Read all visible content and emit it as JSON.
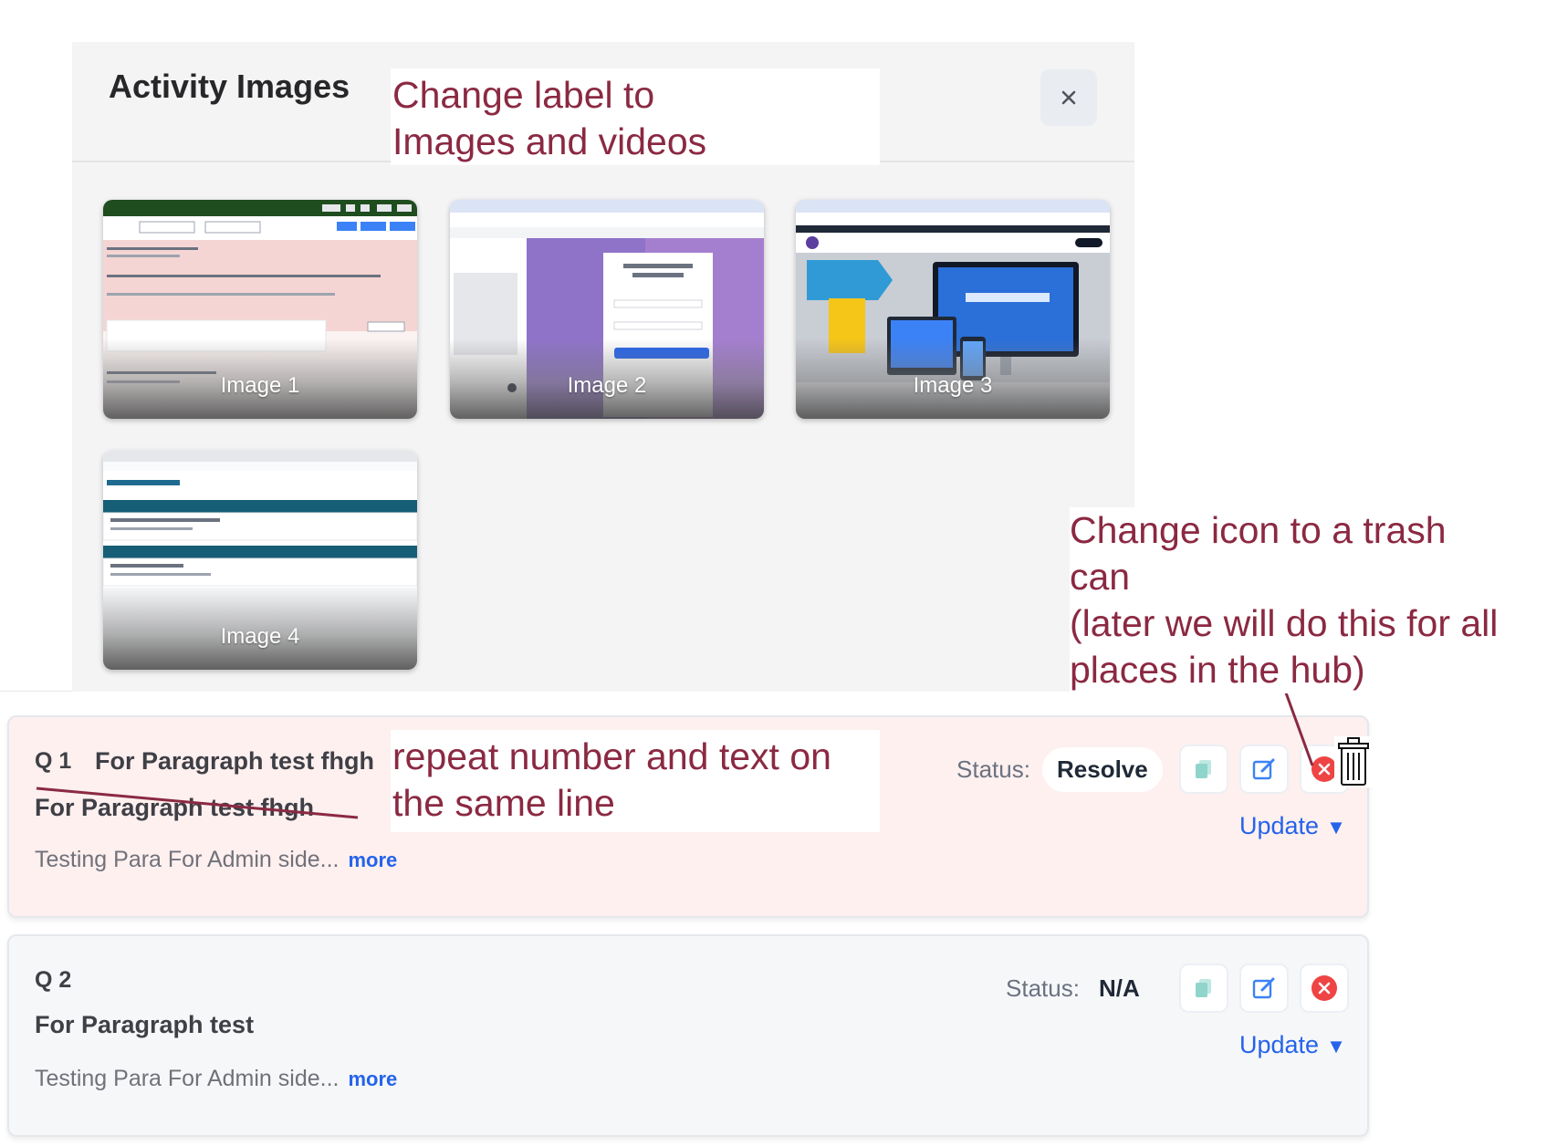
{
  "modal": {
    "title": "Activity Images",
    "close_label": "×",
    "images": [
      {
        "caption": "Image 1"
      },
      {
        "caption": "Image 2"
      },
      {
        "caption": "Image 3"
      },
      {
        "caption": "Image 4"
      }
    ]
  },
  "annotations": {
    "label_note": "Change label to\nImages and videos",
    "icon_note": "Change icon to a trash\ncan\n(later we will do this for all\nplaces in the hub)",
    "line_note": "repeat number and text on\nthe same line"
  },
  "questions": [
    {
      "number": "Q 1",
      "title_inline": "For Paragraph test fhgh",
      "title": "For Paragraph test fhgh",
      "description": "Testing Para For Admin side...",
      "more": "more",
      "status_label": "Status:",
      "status_value": "Resolve",
      "update_label": "Update"
    },
    {
      "number": "Q 2",
      "title": "For Paragraph test",
      "description": "Testing Para For Admin side...",
      "more": "more",
      "status_label": "Status:",
      "status_value": "N/A",
      "update_label": "Update"
    }
  ],
  "colors": {
    "annotation": "#8b2942",
    "link": "#2563eb",
    "delete": "#ef4444",
    "card_highlight": "#fdf0ef",
    "card_default": "#f6f7f9"
  }
}
